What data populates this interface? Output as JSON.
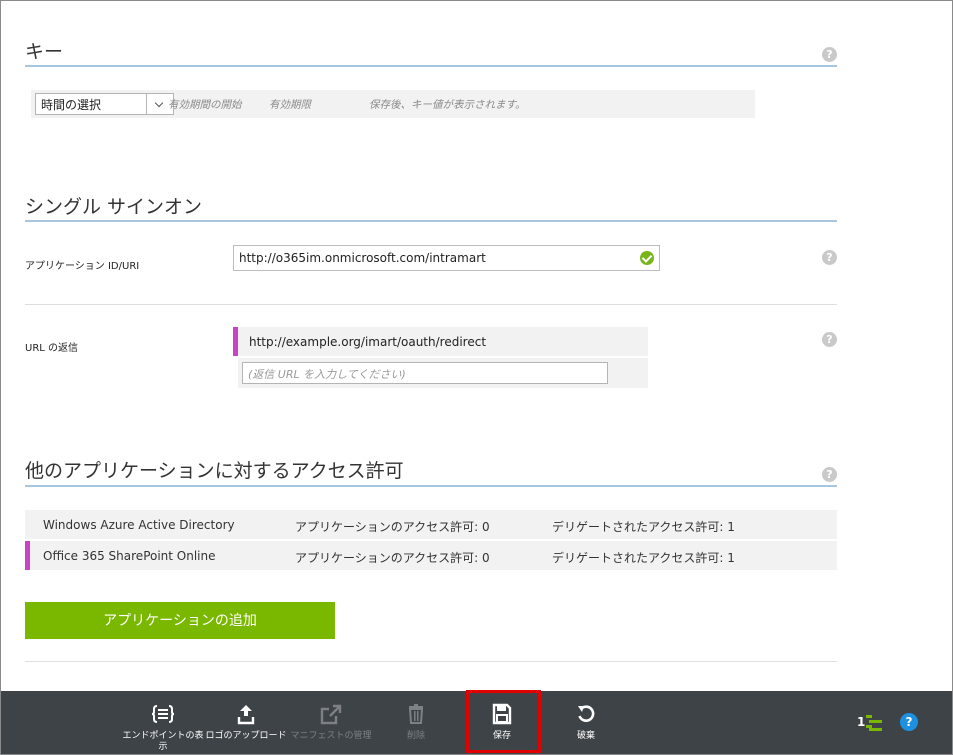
{
  "keys": {
    "title": "キー",
    "time_select": "時間の選択",
    "hint_start": "有効期間の開始",
    "hint_end": "有効期限",
    "hint_after_save": "保存後、キー値が表示されます。"
  },
  "sso": {
    "title": "シングル サインオン",
    "app_id_label": "アプリケーション ID/URI",
    "app_id_value": "http://o365im.onmicrosoft.com/intramart",
    "reply_url_label": "URL の返信",
    "reply_url_value": "http://example.org/imart/oauth/redirect",
    "reply_url_placeholder": "(返信 URL を入力してください)"
  },
  "permissions": {
    "title": "他のアプリケーションに対するアクセス許可",
    "rows": [
      {
        "app": "Windows Azure Active Directory",
        "app_perm": "アプリケーションのアクセス許可: 0",
        "delegated_perm": "デリゲートされたアクセス許可: 1"
      },
      {
        "app": "Office 365 SharePoint Online",
        "app_perm": "アプリケーションのアクセス許可: 0",
        "delegated_perm": "デリゲートされたアクセス許可: 1"
      }
    ],
    "add_button": "アプリケーションの追加"
  },
  "toolbar": {
    "endpoints": "エンドポイントの表示",
    "upload_logo": "ロゴのアップロード",
    "manage_manifest": "マニフェストの管理",
    "delete": "削除",
    "save": "保存",
    "discard": "破棄",
    "count": "1"
  },
  "help": "?",
  "colors": {
    "accent_green": "#7ab800",
    "active_marker": "#c844c4",
    "rule_blue": "#a8c7df",
    "toolbar_bg": "#3e4348",
    "highlight": "#e00000"
  }
}
